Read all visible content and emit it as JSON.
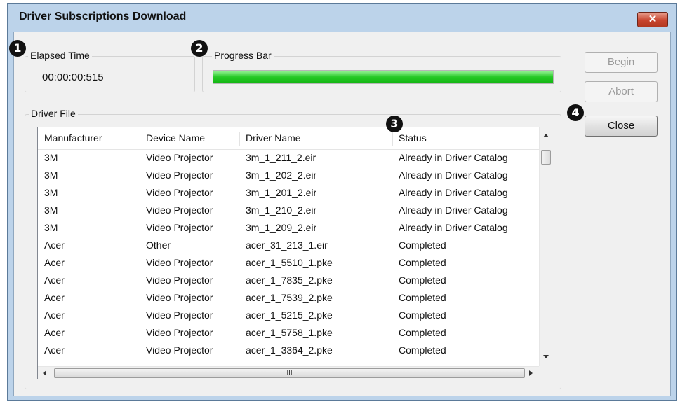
{
  "window": {
    "title": "Driver Subscriptions Download",
    "close_label": "✕"
  },
  "elapsed": {
    "label": "Elapsed Time",
    "value": "00:00:00:515"
  },
  "progress": {
    "label": "Progress Bar",
    "percent": 100,
    "color": "#22c022"
  },
  "buttons": {
    "begin": "Begin",
    "abort": "Abort",
    "close": "Close"
  },
  "driver_file": {
    "label": "Driver File",
    "columns": [
      "Manufacturer",
      "Device Name",
      "Driver Name",
      "Status"
    ],
    "rows": [
      [
        "3M",
        "Video Projector",
        "3m_1_211_2.eir",
        "Already in Driver Catalog"
      ],
      [
        "3M",
        "Video Projector",
        "3m_1_202_2.eir",
        "Already in Driver Catalog"
      ],
      [
        "3M",
        "Video Projector",
        "3m_1_201_2.eir",
        "Already in Driver Catalog"
      ],
      [
        "3M",
        "Video Projector",
        "3m_1_210_2.eir",
        "Already in Driver Catalog"
      ],
      [
        "3M",
        "Video Projector",
        "3m_1_209_2.eir",
        "Already in Driver Catalog"
      ],
      [
        "Acer",
        "Other",
        "acer_31_213_1.eir",
        "Completed"
      ],
      [
        "Acer",
        "Video Projector",
        "acer_1_5510_1.pke",
        "Completed"
      ],
      [
        "Acer",
        "Video Projector",
        "acer_1_7835_2.pke",
        "Completed"
      ],
      [
        "Acer",
        "Video Projector",
        "acer_1_7539_2.pke",
        "Completed"
      ],
      [
        "Acer",
        "Video Projector",
        "acer_1_5215_2.pke",
        "Completed"
      ],
      [
        "Acer",
        "Video Projector",
        "acer_1_5758_1.pke",
        "Completed"
      ],
      [
        "Acer",
        "Video Projector",
        "acer_1_3364_2.pke",
        "Completed"
      ]
    ],
    "hscroll_grip": "III"
  },
  "callouts": [
    "1",
    "2",
    "3",
    "4"
  ]
}
